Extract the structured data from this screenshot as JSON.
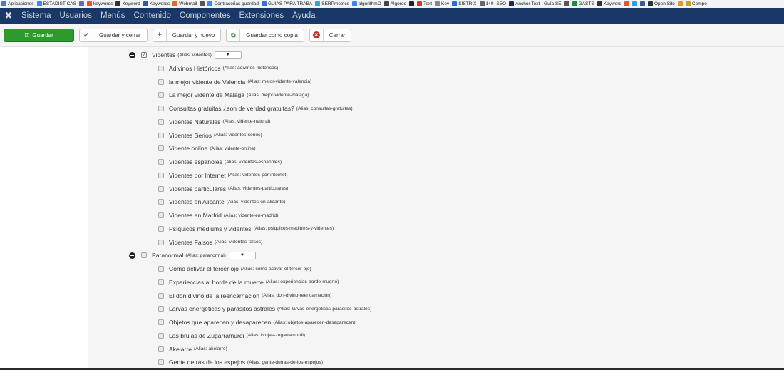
{
  "bookmarks": [
    {
      "label": "Aplicaciones",
      "icon": "apps-icon",
      "color": "#4a7bd1"
    },
    {
      "label": "ESTADISTICAS",
      "icon": "google-icon",
      "color": "#4285f4"
    },
    {
      "label": "",
      "icon": "bookmark-icon",
      "color": "#5f6ab5"
    },
    {
      "label": "keywords",
      "icon": "flame-icon",
      "color": "#e0582a"
    },
    {
      "label": "Keyword",
      "icon": "q-icon",
      "color": "#333333"
    },
    {
      "label": "Keywords",
      "icon": "tool-icon",
      "color": "#2b5ca8"
    },
    {
      "label": "Webmail",
      "icon": "cpanel-icon",
      "color": "#e06c2a"
    },
    {
      "label": "",
      "icon": "user-icon",
      "color": "#555555"
    },
    {
      "label": "Contraseñas guardad",
      "icon": "google-icon",
      "color": "#4285f4"
    },
    {
      "label": "GUIAS PARA TRABA",
      "icon": "docs-icon",
      "color": "#3b6fd6"
    },
    {
      "label": "SERPmetrics",
      "icon": "chart-icon",
      "color": "#36a3e0"
    },
    {
      "label": "algorithmO",
      "icon": "google-icon",
      "color": "#4285f4"
    },
    {
      "label": "Algoroo",
      "icon": "play-icon",
      "color": "#444444"
    },
    {
      "label": "",
      "icon": "pin-icon",
      "color": "#222222"
    },
    {
      "label": "Text",
      "icon": "bars-icon",
      "color": "#d33a2c"
    },
    {
      "label": "Key",
      "icon": "page-icon",
      "color": "#888888"
    },
    {
      "label": "SISTRIX",
      "icon": "search-icon",
      "color": "#2a6fd6"
    },
    {
      "label": "140 -SEO",
      "icon": "list-icon",
      "color": "#666666"
    },
    {
      "label": "Anchor Text - Guía SE",
      "icon": "gg-icon",
      "color": "#1d2b4a"
    },
    {
      "label": "",
      "icon": "plus-icon",
      "color": "#555555"
    },
    {
      "label": "GASTS",
      "icon": "sheet-icon",
      "color": "#1e8e3e"
    },
    {
      "label": "Keyword",
      "icon": "m-icon",
      "color": "#333333"
    },
    {
      "label": "",
      "icon": "flame-icon",
      "color": "#e0582a"
    },
    {
      "label": "",
      "icon": "twitter-icon",
      "color": "#1da1f2"
    },
    {
      "label": "",
      "icon": "facebook-icon",
      "color": "#3b5998"
    },
    {
      "label": "Open Site",
      "icon": "m-icon",
      "color": "#333333"
    },
    {
      "label": "",
      "icon": "signal-icon",
      "color": "#e69a1a"
    },
    {
      "label": "Compe",
      "icon": "flag-icon",
      "color": "#c9a227"
    }
  ],
  "nav": {
    "items": [
      "Sistema",
      "Usuarios",
      "Menús",
      "Contenido",
      "Componentes",
      "Extensiones",
      "Ayuda"
    ]
  },
  "toolbar": {
    "save": "Guardar",
    "save_close": "Guardar y cerrar",
    "save_new": "Guardar y nuevo",
    "save_copy": "Guardar como copia",
    "close": "Cerrar"
  },
  "categories": [
    {
      "label": "Videntes",
      "alias": "(Alias: videntes)",
      "checked": true,
      "children": [
        {
          "label": "Adivinos Históricos",
          "alias": "(Alias: adivinos-historicos)"
        },
        {
          "label": "la mejor vidente de Valencia",
          "alias": "(Alias: mejor-vidente-valencia)"
        },
        {
          "label": "La mejor vidente de Málaga",
          "alias": "(Alias: mejor-vidente-malaga)"
        },
        {
          "label": "Consultas gratuitas ¿son de verdad gratuitas?",
          "alias": "(Alias: consultas-gratuitas)"
        },
        {
          "label": "Videntes Naturales",
          "alias": "(Alias: vidente-natural)"
        },
        {
          "label": "Videntes Serios",
          "alias": "(Alias: videntes-serios)"
        },
        {
          "label": "Vidente online",
          "alias": "(Alias: vidente-online)"
        },
        {
          "label": "Videntes españoles",
          "alias": "(Alias: videntes-espanoles)"
        },
        {
          "label": "Videntes por Internet",
          "alias": "(Alias: videntes-por-internet)"
        },
        {
          "label": "Videntes particulares",
          "alias": "(Alias: videntes-particulares)"
        },
        {
          "label": "Videntes en Alicante",
          "alias": "(Alias: videntes-en-alicante)"
        },
        {
          "label": "Videntes en Madrid",
          "alias": "(Alias: vidente-en-madrid)"
        },
        {
          "label": "Psíquicos médiums y videntes",
          "alias": "(Alias: psiquicos-mediums-y-videntes)"
        },
        {
          "label": "Videntes Falsos",
          "alias": "(Alias: videntes-falsos)"
        }
      ]
    },
    {
      "label": "Paranormal",
      "alias": "(Alias: paranormal)",
      "checked": false,
      "children": [
        {
          "label": "Como activar el tercer ojo",
          "alias": "(Alias: como-activar-el-tercer-ojo)"
        },
        {
          "label": "Experiencias al borde de la muerte",
          "alias": "(Alias: experiencias-borde-muerte)"
        },
        {
          "label": "El don divino de la reencarnación",
          "alias": "(Alias: don-divino-reencarnacion)"
        },
        {
          "label": "Larvas energéticas y parásitos astrales",
          "alias": "(Alias: larvas-energeticas-parasitos-astrales)"
        },
        {
          "label": "Objetos que aparecen y desaparecen",
          "alias": "(Alias: objetos-aparecen-desaparecen)"
        },
        {
          "label": "Las brujas de Zugarramurdi",
          "alias": "(Alias: brujas-zugarramurdi)"
        },
        {
          "label": "Akelarre",
          "alias": "(Alias: akelarre)"
        },
        {
          "label": "Gente detrás de los espejos",
          "alias": "(Alias: gente-detras-de-los-espejos)"
        }
      ]
    }
  ]
}
